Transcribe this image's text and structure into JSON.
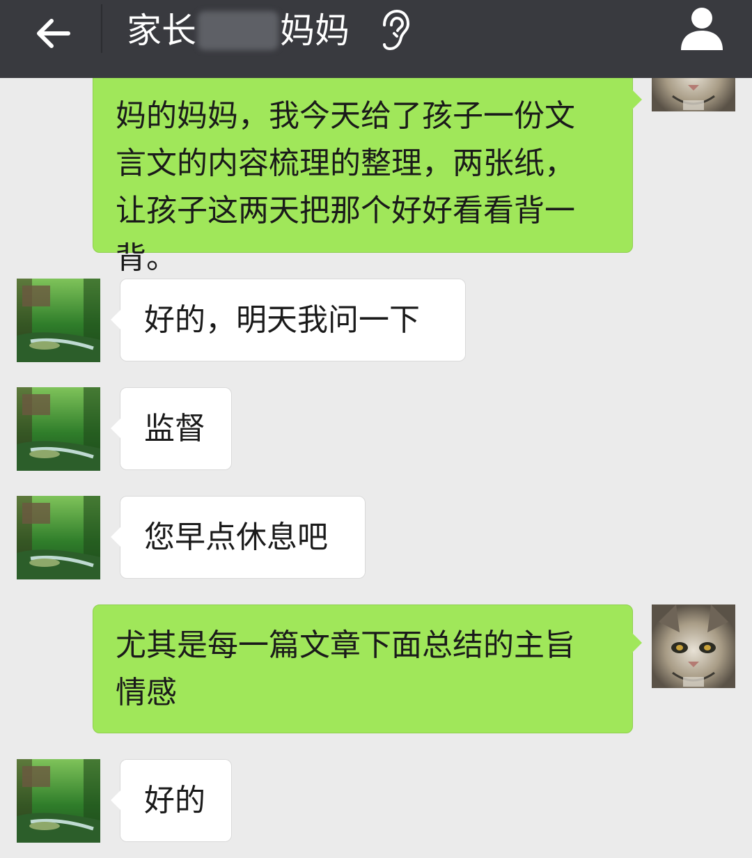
{
  "header": {
    "title_left": "家长",
    "title_right": "妈妈",
    "icons": {
      "back": "arrow-left-icon",
      "voice_mode": "ear-icon",
      "profile": "person-icon"
    }
  },
  "messages": [
    {
      "direction": "out",
      "text": "妈的妈妈，我今天给了孩子一份文\n言文的内容梳理的整理，两张纸，\n让孩子这两天把那个好好看看背一\n背。"
    },
    {
      "direction": "in",
      "text": "好的，明天我问一下"
    },
    {
      "direction": "in",
      "text": "监督"
    },
    {
      "direction": "in",
      "text": "您早点休息吧"
    },
    {
      "direction": "out",
      "text": "尤其是每一篇文章下面总结的主旨\n情感"
    },
    {
      "direction": "in",
      "text": "好的"
    }
  ],
  "colors": {
    "header_bg": "#393a3f",
    "chat_bg": "#ebebeb",
    "outgoing_bubble": "#a0e75a",
    "incoming_bubble": "#ffffff"
  }
}
